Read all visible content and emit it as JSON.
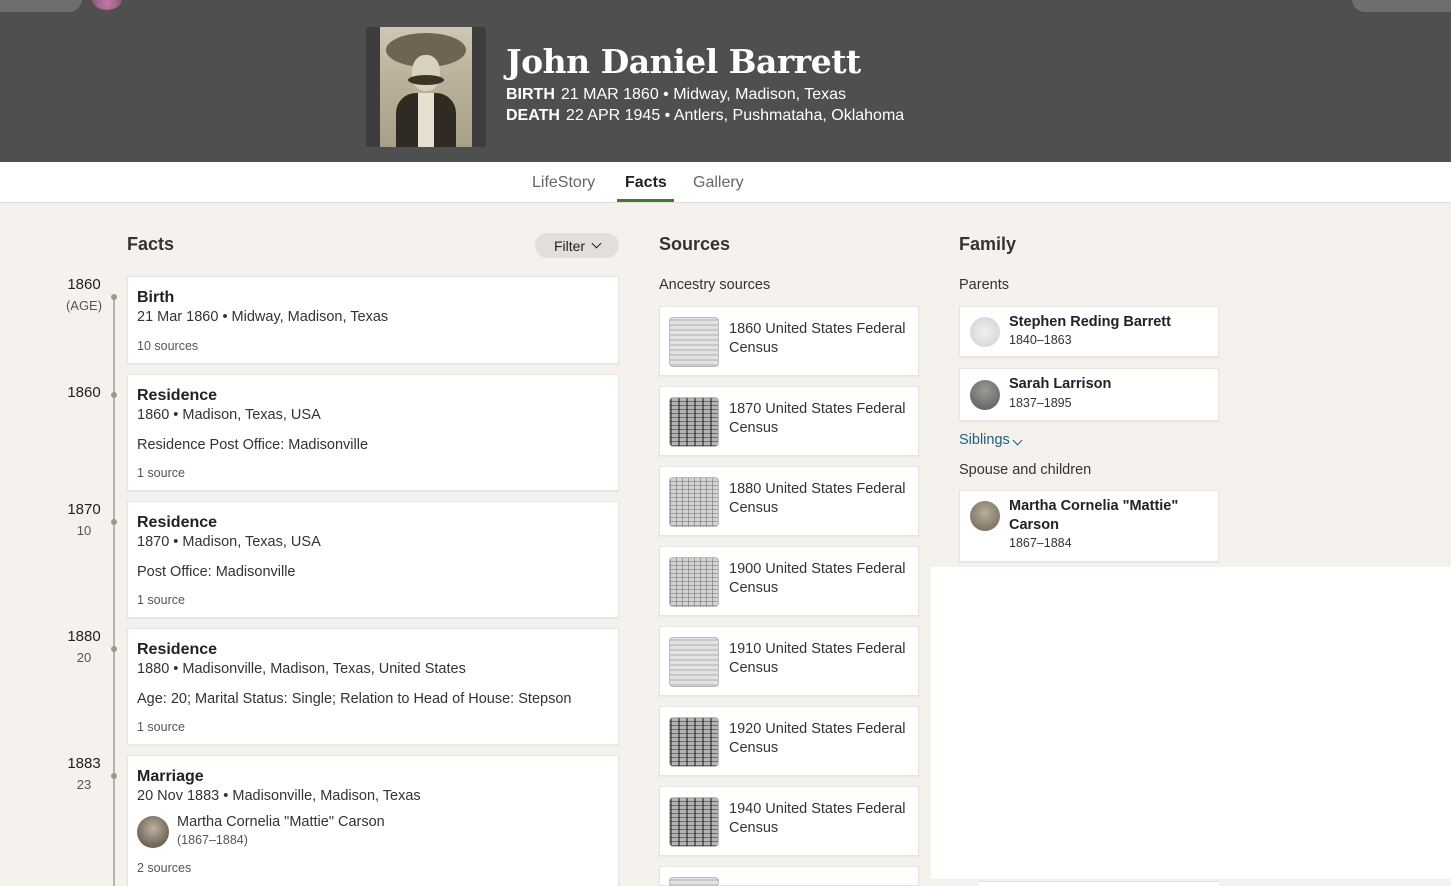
{
  "person": {
    "name": "John Daniel Barrett",
    "birth": {
      "label": "BIRTH",
      "value": "21 MAR 1860 • Midway, Madison, Texas"
    },
    "death": {
      "label": "DEATH",
      "value": "22 APR 1945 • Antlers, Pushmataha, Oklahoma"
    }
  },
  "tabs": [
    {
      "label": "LifeStory",
      "active": false
    },
    {
      "label": "Facts",
      "active": true
    },
    {
      "label": "Gallery",
      "active": false
    }
  ],
  "facts": {
    "title": "Facts",
    "filter_label": "Filter",
    "timeline": [
      {
        "year": "1860",
        "age": "(AGE)"
      },
      {
        "year": "1860",
        "age": ""
      },
      {
        "year": "1870",
        "age": "10"
      },
      {
        "year": "1880",
        "age": "20"
      },
      {
        "year": "1883",
        "age": "23"
      }
    ],
    "items": [
      {
        "title": "Birth",
        "line": "21 Mar 1860 • Midway, Madison, Texas",
        "sources": "10 sources"
      },
      {
        "title": "Residence",
        "line": "1860 • Madison, Texas, USA",
        "detail": "Residence Post Office: Madisonville",
        "sources": "1 source"
      },
      {
        "title": "Residence",
        "line": "1870 • Madison, Texas, USA",
        "detail": "Post Office: Madisonville",
        "sources": "1 source"
      },
      {
        "title": "Residence",
        "line": "1880 • Madisonville, Madison, Texas, United States",
        "detail": "Age: 20; Marital Status: Single; Relation to Head of House: Stepson",
        "sources": "1 source"
      },
      {
        "title": "Marriage",
        "line": "20 Nov 1883 • Madisonville, Madison, Texas",
        "spouse_name": "Martha Cornelia \"Mattie\" Carson",
        "spouse_dates": "(1867–1884)",
        "sources": "2 sources"
      }
    ]
  },
  "sources": {
    "title": "Sources",
    "subtitle": "Ancestry sources",
    "items": [
      "1860 United States Federal Census",
      "1870 United States Federal Census",
      "1880 United States Federal Census",
      "1900 United States Federal Census",
      "1910 United States Federal Census",
      "1920 United States Federal Census",
      "1940 United States Federal Census"
    ]
  },
  "family": {
    "title": "Family",
    "parents_label": "Parents",
    "parents": [
      {
        "name": "Stephen Reding Barrett",
        "dates": "1840–1863"
      },
      {
        "name": "Sarah Larrison",
        "dates": "1837–1895"
      }
    ],
    "siblings_label": "Siblings",
    "spouse_label": "Spouse and children",
    "spouses": [
      {
        "name": "Martha Cornelia \"Mattie\" Carson",
        "dates": "1867–1884"
      }
    ]
  }
}
